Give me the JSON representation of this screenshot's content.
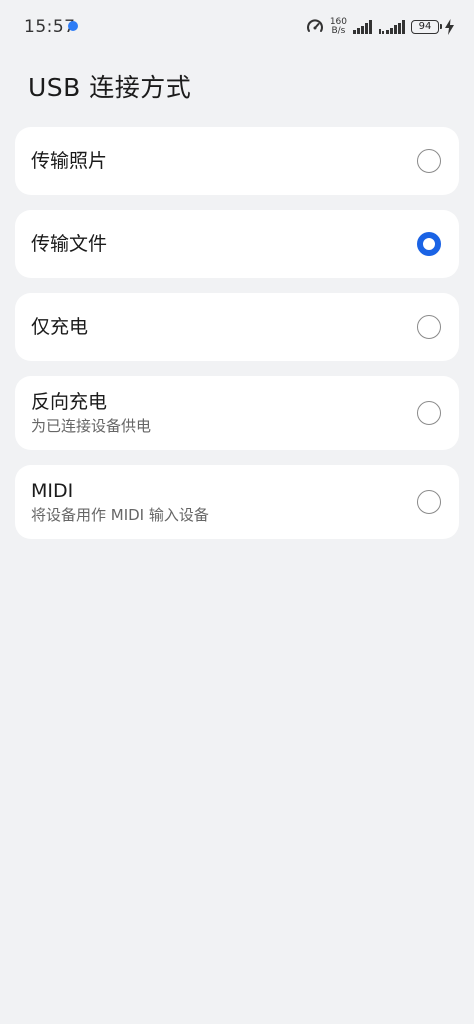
{
  "status_bar": {
    "time": "15:57",
    "net_speed_value": "160",
    "net_speed_unit": "B/s",
    "battery_level": "94",
    "accent_color": "#2d7cf6"
  },
  "header": {
    "title": "USB 连接方式"
  },
  "options": [
    {
      "title": "传输照片",
      "subtitle": "",
      "selected": false
    },
    {
      "title": "传输文件",
      "subtitle": "",
      "selected": true
    },
    {
      "title": "仅充电",
      "subtitle": "",
      "selected": false
    },
    {
      "title": "反向充电",
      "subtitle": "为已连接设备供电",
      "selected": false
    },
    {
      "title": "MIDI",
      "subtitle": "将设备用作 MIDI 输入设备",
      "selected": false
    }
  ],
  "colors": {
    "background": "#f1f2f4",
    "card": "#ffffff",
    "radio_selected": "#1a63e5",
    "radio_unselected": "#8a8a8a"
  }
}
